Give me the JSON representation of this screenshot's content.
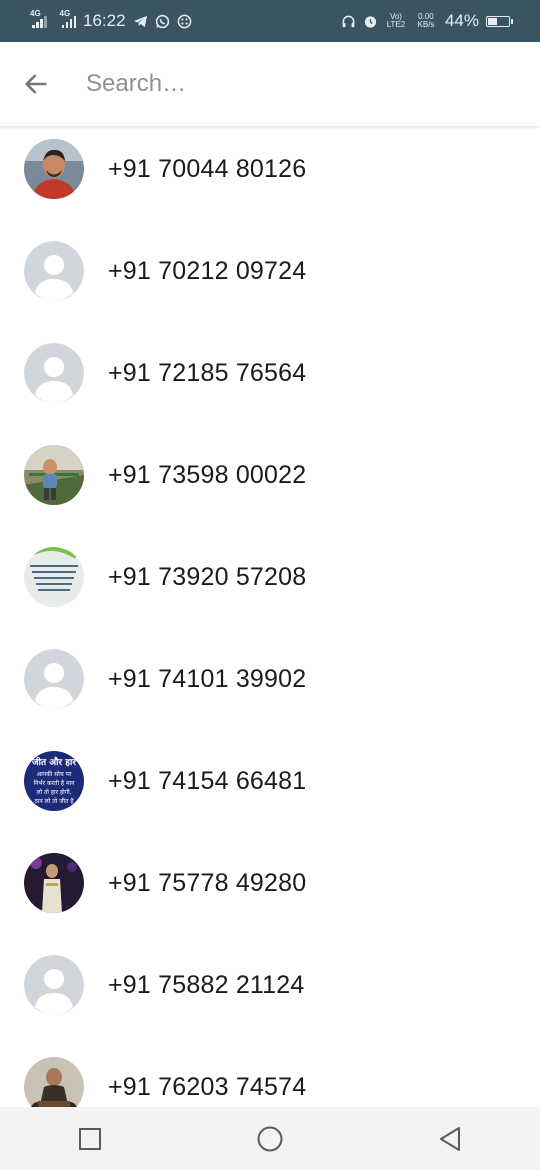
{
  "status_bar": {
    "net1": "4G",
    "net2": "4G",
    "time": "16:22",
    "volte": "Vo) LTE2",
    "speed": "0.00 KB/s",
    "battery_pct": "44%",
    "battery_level": 0.44,
    "icons_left": [
      "telegram-icon",
      "whatsapp-icon",
      "dialer-icon"
    ],
    "icons_right": [
      "headphones-icon",
      "clock-icon",
      "battery-icon"
    ]
  },
  "search": {
    "placeholder": "Search…",
    "value": ""
  },
  "contacts": [
    {
      "phone": "+91 70044 80126",
      "avatar": "photo-man-red-shirt"
    },
    {
      "phone": "+91 70212 09724",
      "avatar": "default"
    },
    {
      "phone": "+91 72185 76564",
      "avatar": "default"
    },
    {
      "phone": "+91 73598 00022",
      "avatar": "photo-child-outdoors"
    },
    {
      "phone": "+91 73920 57208",
      "avatar": "photo-hindi-quote-light"
    },
    {
      "phone": "+91 74101 39902",
      "avatar": "default"
    },
    {
      "phone": "+91 74154 66481",
      "avatar": "photo-hindi-quote-blue",
      "avatar_text": [
        "जीत और हार",
        "आपकी सोच पर",
        "निर्भर करती है मान",
        "लो तो हार होगी,",
        "ठान लो तो जीत है"
      ]
    },
    {
      "phone": "+91 75778 49280",
      "avatar": "photo-man-purple-light"
    },
    {
      "phone": "+91 75882 21124",
      "avatar": "default"
    },
    {
      "phone": "+91 76203 74574",
      "avatar": "photo-man-motorbike"
    }
  ],
  "colors": {
    "status_bar": "#3a5561",
    "default_avatar_bg": "#d0d6db",
    "nav_bar": "#f3f3f3"
  },
  "nav": [
    "recents-button",
    "home-button",
    "back-button"
  ]
}
